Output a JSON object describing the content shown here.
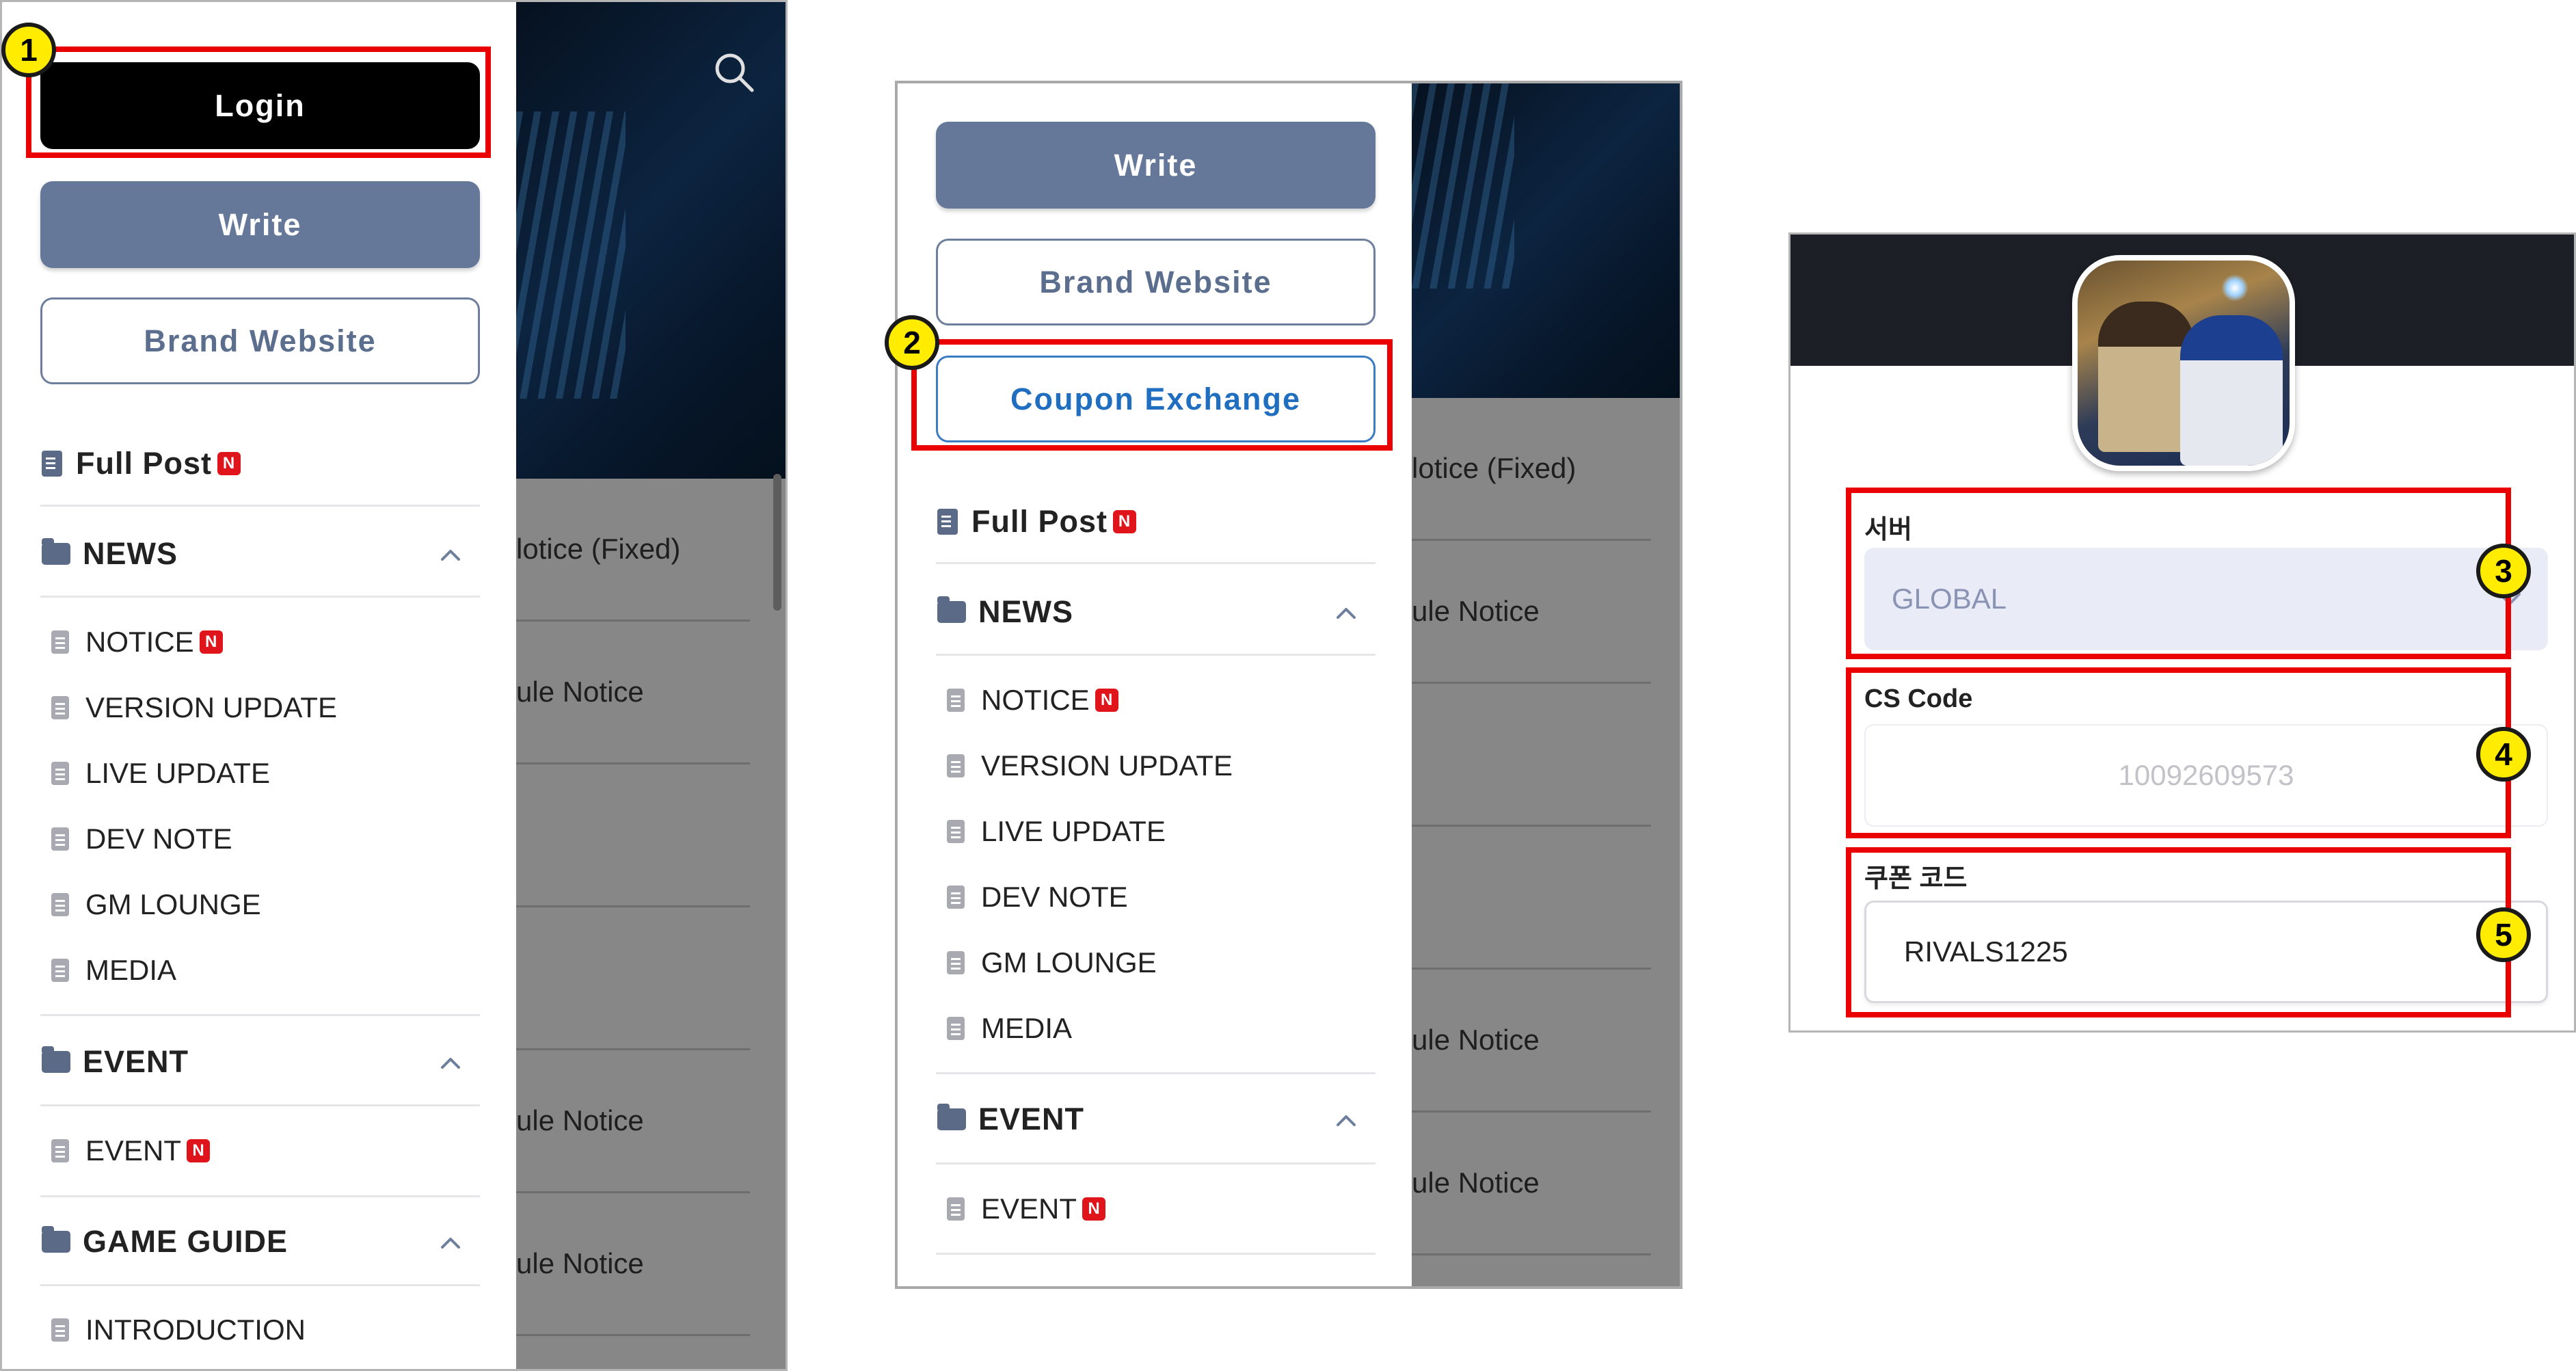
{
  "panel1": {
    "login_label": "Login",
    "write_label": "Write",
    "brand_label": "Brand Website",
    "full_post_label": "Full Post",
    "badge": "N",
    "news_label": "NEWS",
    "news_items": [
      "NOTICE",
      "VERSION UPDATE",
      "LIVE UPDATE",
      "DEV NOTE",
      "GM LOUNGE",
      "MEDIA"
    ],
    "event_label": "EVENT",
    "event_items": [
      "EVENT"
    ],
    "guide_label": "GAME GUIDE",
    "guide_items": [
      "INTRODUCTION"
    ],
    "background_rows": [
      "lotice (Fixed)",
      "ule Notice",
      "",
      "",
      "ule Notice",
      "ule Notice"
    ]
  },
  "panel2": {
    "write_label": "Write",
    "brand_label": "Brand Website",
    "coupon_label": "Coupon Exchange",
    "full_post_label": "Full Post",
    "badge": "N",
    "news_label": "NEWS",
    "news_items": [
      "NOTICE",
      "VERSION UPDATE",
      "LIVE UPDATE",
      "DEV NOTE",
      "GM LOUNGE",
      "MEDIA"
    ],
    "event_label": "EVENT",
    "event_items": [
      "EVENT"
    ],
    "background_rows": [
      "lotice (Fixed)",
      "ule Notice",
      "",
      "",
      "ule Notice",
      "ule Notice"
    ]
  },
  "panel3": {
    "server_label": "서버",
    "server_value": "GLOBAL",
    "cs_label": "CS Code",
    "cs_value": "10092609573",
    "coupon_label": "쿠폰 코드",
    "coupon_value": "RIVALS1225"
  },
  "callouts": [
    "1",
    "2",
    "3",
    "4",
    "5"
  ],
  "colors": {
    "highlight": "#ea0000",
    "callout": "#ffec00",
    "write_button": "#66789a",
    "coupon_text": "#1f6ec0",
    "badge": "#e0151b"
  }
}
